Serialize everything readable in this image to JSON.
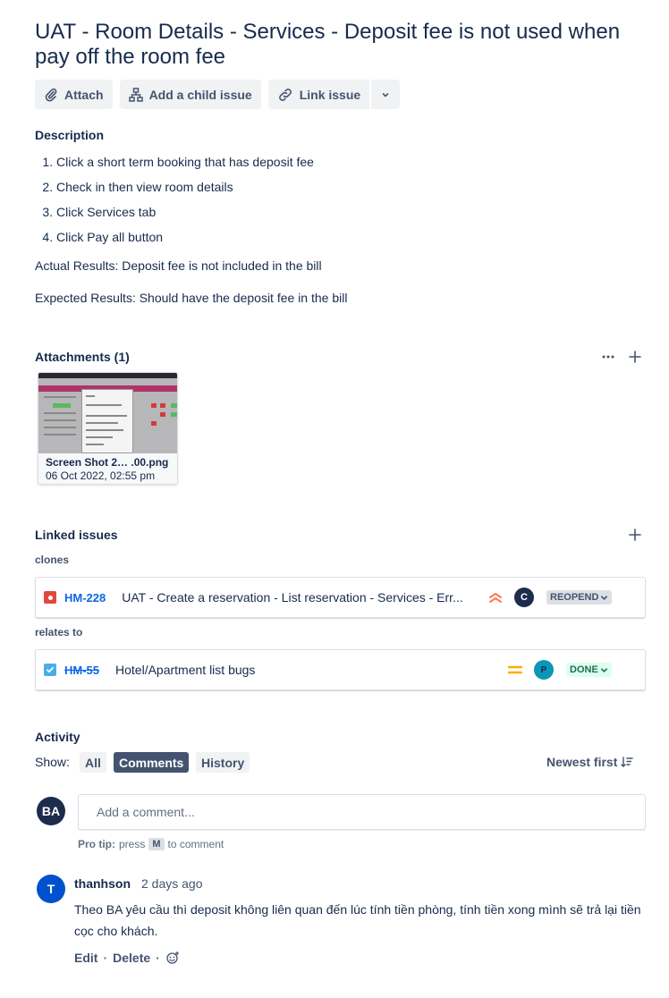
{
  "issue": {
    "title": "UAT - Room Details - Services - Deposit fee is not used when pay off the room fee"
  },
  "actions": {
    "attach": "Attach",
    "add_child": "Add a child issue",
    "link_issue": "Link issue"
  },
  "description": {
    "heading": "Description",
    "steps": [
      "Click a short term booking that has deposit fee",
      "Check in then view room details",
      "Click Services tab",
      "Click Pay all button"
    ],
    "actual": "Actual Results: Deposit fee is not included in the bill",
    "expected": "Expected Results: Should have the deposit fee in the bill"
  },
  "attachments": {
    "heading": "Attachments (1)",
    "items": [
      {
        "name": "Screen Shot 2…   .00.png",
        "date": "06 Oct 2022, 02:55 pm"
      }
    ]
  },
  "linked": {
    "heading": "Linked issues",
    "groups": [
      {
        "relation": "clones",
        "issue": {
          "key": "HM-228",
          "summary": "UAT - Create a reservation - List reservation - Services - Err...",
          "assignee_initial": "C",
          "status": "REOPEND",
          "priority": "highest",
          "type": "bug"
        }
      },
      {
        "relation": "relates to",
        "issue": {
          "key": "HM-55",
          "summary": "Hotel/Apartment list bugs",
          "assignee_initial": "P",
          "status": "DONE",
          "priority": "medium",
          "type": "task"
        }
      }
    ]
  },
  "activity": {
    "heading": "Activity",
    "show_label": "Show:",
    "filters": [
      "All",
      "Comments",
      "History"
    ],
    "active_filter": "Comments",
    "sort": "Newest first",
    "current_user_initials": "BA",
    "placeholder": "Add a comment...",
    "pro_tip_label": "Pro tip:",
    "pro_tip_press": "press",
    "pro_tip_key": "M",
    "pro_tip_suffix": "to comment",
    "comments": [
      {
        "avatar_initial": "T",
        "author": "thanhson",
        "time": "2 days ago",
        "body": "Theo BA yêu cầu thì deposit không liên quan đến lúc tính tiền phòng, tính tiền xong mình sẽ trả lại tiền cọc cho khách.",
        "edit": "Edit",
        "delete": "Delete"
      }
    ]
  },
  "colors": {
    "text": "#172b4d",
    "link": "#0c66e4",
    "button_bg": "#f1f2f4",
    "active_filter_bg": "#44546f",
    "reopen_bg": "#dcdfe4",
    "done_bg": "#dcfff1",
    "done_text": "#216e4e",
    "bug_red": "#e2483d",
    "task_blue": "#4bade8",
    "avatar_navy": "#1d2b4d",
    "avatar_teal": "#0b96b8",
    "avatar_blue": "#0052cc",
    "priority_orange": "#ff7452",
    "priority_medium": "#ffab00"
  }
}
